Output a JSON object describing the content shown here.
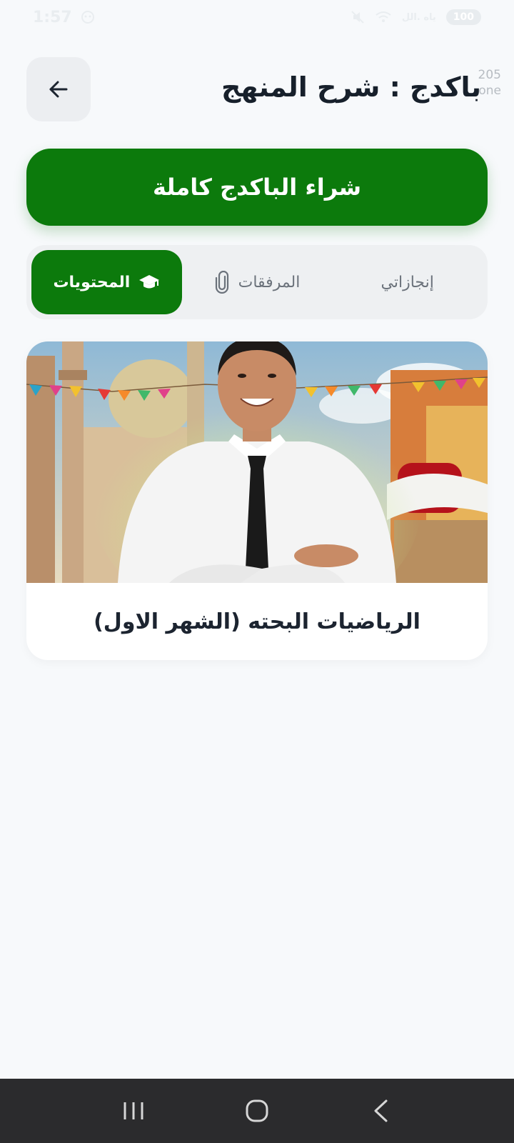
{
  "status_bar": {
    "time": "1:57",
    "carrier_hint": "ياه .الل",
    "battery": "100"
  },
  "header": {
    "title": "باكدج : شرح المنهج",
    "overlay_line1": "205",
    "overlay_line2": "one"
  },
  "buy_button": {
    "label": "شراء الباكدج كاملة"
  },
  "tabs": [
    {
      "label": "المحتويات",
      "icon": "graduation-cap-icon",
      "active": true
    },
    {
      "label": "المرفقات",
      "icon": "paperclip-icon",
      "active": false
    },
    {
      "label": "إنجازاتي",
      "icon": "",
      "active": false
    }
  ],
  "course": {
    "title": "الرياضيات البحته (الشهر الاول)"
  },
  "colors": {
    "accent": "#0c7a0c",
    "background": "#f7f9fb",
    "nav_bar": "#2b2b2d"
  }
}
